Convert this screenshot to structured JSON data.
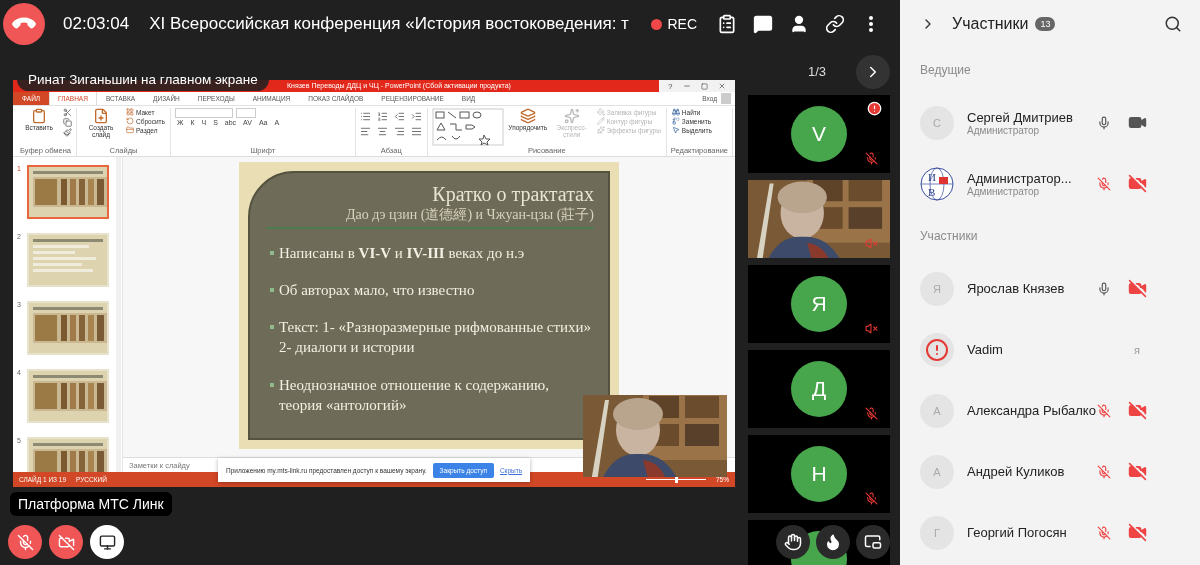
{
  "top_bar": {
    "time": "02:03:04",
    "title": "XI Всероссийская конференция «История востоковедения: т",
    "recording": "REC"
  },
  "pager": {
    "page": "1/3"
  },
  "presenter_label": "Ринат Зиганьшин на главном экране",
  "powerpoint": {
    "title": "Князев Переводы ДДЦ и ЧЦ - PowerPoint (Сбой активации продукта)",
    "help": "?",
    "account": "Вход",
    "tabs": [
      {
        "label": "ФАЙЛ",
        "kind": "file",
        "selected": false
      },
      {
        "label": "ГЛАВНАЯ",
        "kind": "tab",
        "selected": true
      },
      {
        "label": "ВСТАВКА",
        "kind": "tab",
        "selected": false
      },
      {
        "label": "ДИЗАЙН",
        "kind": "tab",
        "selected": false
      },
      {
        "label": "ПЕРЕХОДЫ",
        "kind": "tab",
        "selected": false
      },
      {
        "label": "АНИМАЦИЯ",
        "kind": "tab",
        "selected": false
      },
      {
        "label": "ПОКАЗ СЛАЙДОВ",
        "kind": "tab",
        "selected": false
      },
      {
        "label": "РЕЦЕНЗИРОВАНИЕ",
        "kind": "tab",
        "selected": false
      },
      {
        "label": "ВИД",
        "kind": "tab",
        "selected": false
      }
    ],
    "ribbon": [
      {
        "label": "Буфер обмена",
        "kind": "clipboard",
        "buttons": [
          {
            "label": "Вставить",
            "kind": "large",
            "disabled": false
          }
        ]
      },
      {
        "label": "Слайды",
        "kind": "slides",
        "buttons": [
          {
            "label": "Создать слайд",
            "kind": "large",
            "disabled": false
          },
          {
            "label": "Макет",
            "kind": "small",
            "disabled": false
          },
          {
            "label": "Сбросить",
            "kind": "small",
            "disabled": false
          },
          {
            "label": "Раздел",
            "kind": "small",
            "disabled": false
          }
        ]
      },
      {
        "label": "Шрифт",
        "kind": "font",
        "buttons": [
          {
            "label": "Ж",
            "kind": "letter",
            "disabled": false
          },
          {
            "label": "К",
            "kind": "letter",
            "disabled": false
          },
          {
            "label": "Ч",
            "kind": "letter",
            "disabled": false
          },
          {
            "label": "S",
            "kind": "letter",
            "disabled": false
          },
          {
            "label": "abc",
            "kind": "letter",
            "disabled": false
          },
          {
            "label": "AV",
            "kind": "letter",
            "disabled": false
          },
          {
            "label": "Aa",
            "kind": "letter",
            "disabled": false
          },
          {
            "label": "A",
            "kind": "letter",
            "disabled": false
          }
        ]
      },
      {
        "label": "Абзац",
        "kind": "paragraph"
      },
      {
        "label": "Рисование",
        "kind": "drawing",
        "buttons": [
          {
            "label": "Упорядочить",
            "kind": "large",
            "disabled": false
          },
          {
            "label": "Экспресс-стили",
            "kind": "large",
            "disabled": true
          },
          {
            "label": "Заливка фигуры",
            "kind": "small",
            "disabled": true
          },
          {
            "label": "Контур фигуры",
            "kind": "small",
            "disabled": true
          },
          {
            "label": "Эффекты фигуры",
            "kind": "small",
            "disabled": true
          }
        ]
      },
      {
        "label": "Редактирование",
        "kind": "editing",
        "buttons": [
          {
            "label": "Найти",
            "kind": "small",
            "disabled": false
          },
          {
            "label": "Заменить",
            "kind": "small",
            "disabled": false
          },
          {
            "label": "Выделить",
            "kind": "small",
            "disabled": false
          }
        ]
      }
    ],
    "slides": [
      {
        "number": "1",
        "selected": true
      },
      {
        "number": "2",
        "kind": "text",
        "selected": false
      },
      {
        "number": "3",
        "selected": false
      },
      {
        "number": "4",
        "selected": false
      },
      {
        "number": "5",
        "selected": false
      }
    ],
    "slide": {
      "title": "Кратко о трактатах",
      "subtitle": "Дао дэ цзин (道德經) и Чжуан-цзы (莊子)",
      "bullets": [
        "Написаны в **VI-V** и **IV-III**  веках до н.э",
        "Об авторах мало, что известно",
        "Текст: 1- «Разноразмерные рифмованные стихи» 2- диалоги и истории",
        "Неоднозначное отношение к содержанию, теория «антологий»"
      ]
    },
    "notes": {
      "placeholder": "Заметки к слайду"
    },
    "status_bar": {
      "slide": "СЛАЙД 1 ИЗ 19",
      "language": "РУССКИЙ",
      "zoom": "75%",
      "level": 0.5
    }
  },
  "share_notice": {
    "text": "Приложению my.mts-link.ru предоставлен доступ к вашему экрану.",
    "stop_button": "Закрыть доступ",
    "hide_link": "Скрыть"
  },
  "platform_label": "Платформа МТС Линк",
  "controls": [
    {
      "kind": "mic",
      "on": false
    },
    {
      "kind": "camera",
      "on": false
    },
    {
      "kind": "screen",
      "on": true
    }
  ],
  "tiles": [
    {
      "kind": "avatar",
      "initial": "V",
      "alert": true,
      "mic_on": false
    },
    {
      "kind": "video",
      "alert": false,
      "sound_on": false
    },
    {
      "kind": "avatar",
      "initial": "Я",
      "alert": false,
      "sound_on": false
    },
    {
      "kind": "avatar",
      "initial": "Д",
      "alert": false,
      "mic_on": false
    },
    {
      "kind": "avatar",
      "initial": "Н",
      "alert": false,
      "mic_on": false
    },
    {
      "kind": "avatar",
      "alert": false
    }
  ],
  "tile_actions": [
    {
      "kind": "raise_hand"
    },
    {
      "kind": "reaction"
    },
    {
      "kind": "picture_in_picture"
    }
  ],
  "participants": {
    "title": "Участники",
    "count": "13",
    "sections": [
      {
        "title": "Ведущие",
        "people": [
          {
            "name": "Сергей Дмитриев",
            "role": "Администратор",
            "avatar": {
              "kind": "letter",
              "letter": "С"
            },
            "mic_on": true,
            "camera_on": true
          },
          {
            "name": "Администратор...",
            "role": "Администратор",
            "avatar": {
              "kind": "logo",
              "letters": [
                "И",
                "В"
              ]
            },
            "mic_on": false,
            "camera_on": false
          }
        ]
      },
      {
        "title": "Участники",
        "people": [
          {
            "name": "Ярослав Князев",
            "avatar": {
              "kind": "letter",
              "letter": "Я"
            },
            "mic_on": true,
            "camera_on": false
          },
          {
            "name": "Vadim",
            "avatar": {
              "kind": "alert"
            },
            "tag": "я"
          },
          {
            "name": "Александра Рыбалко",
            "avatar": {
              "kind": "letter",
              "letter": "А"
            },
            "mic_on": false,
            "camera_on": false
          },
          {
            "name": "Андрей Куликов",
            "avatar": {
              "kind": "letter",
              "letter": "А"
            },
            "mic_on": false,
            "camera_on": false
          },
          {
            "name": "Георгий Погосян",
            "avatar": {
              "kind": "letter",
              "letter": "Г"
            },
            "mic_on": false,
            "camera_on": false
          }
        ]
      }
    ]
  }
}
